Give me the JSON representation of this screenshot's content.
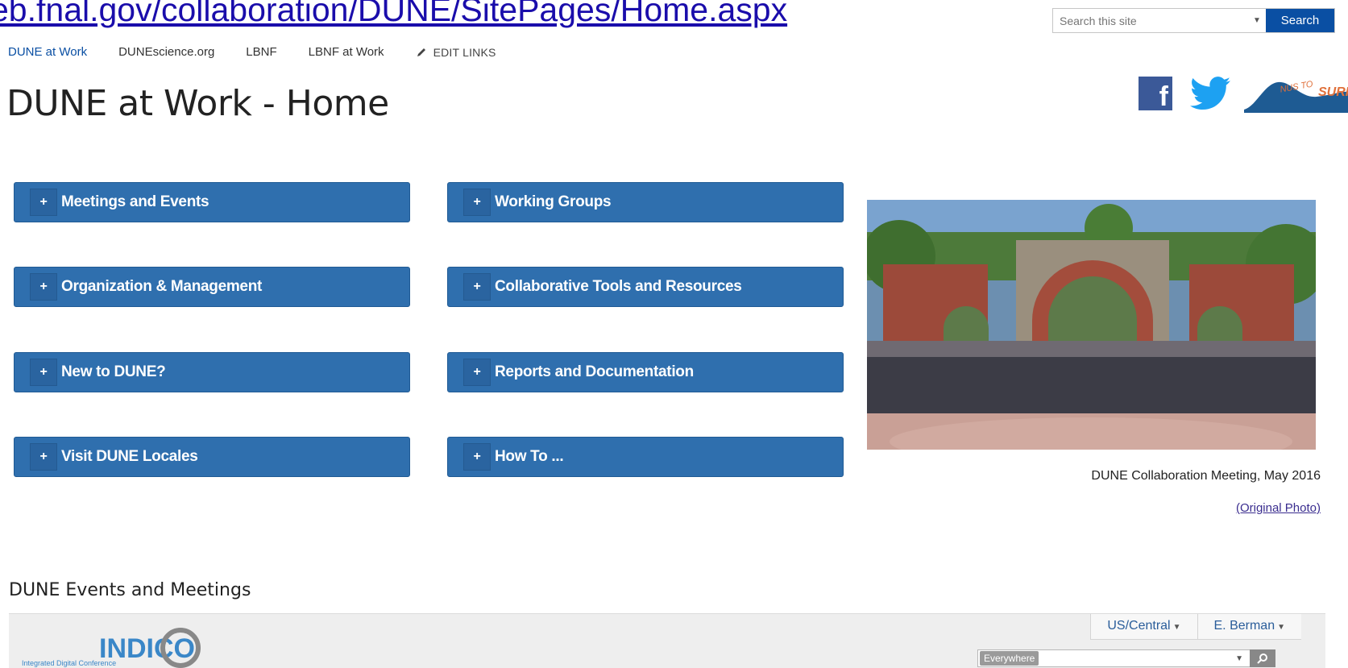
{
  "browser": {
    "url_text": "eb.fnal.gov/collaboration/DUNE/SitePages/Home.aspx"
  },
  "search": {
    "placeholder": "Search this site",
    "button_label": "Search"
  },
  "topnav": {
    "items": [
      {
        "label": "DUNE at Work",
        "active": true
      },
      {
        "label": "DUNEscience.org",
        "active": false
      },
      {
        "label": "LBNF",
        "active": false
      },
      {
        "label": "LBNF at Work",
        "active": false
      }
    ],
    "edit_links_label": "EDIT LINKS"
  },
  "page": {
    "title": "DUNE at Work - Home"
  },
  "social": {
    "facebook_glyph": "f",
    "surf_logo_text": "NUS TO SURF"
  },
  "accordions": {
    "left": [
      {
        "label": "Meetings and Events"
      },
      {
        "label": "Organization & Management"
      },
      {
        "label": "New to DUNE?"
      },
      {
        "label": "Visit DUNE Locales"
      }
    ],
    "right": [
      {
        "label": "Working Groups"
      },
      {
        "label": "Collaborative Tools and Resources"
      },
      {
        "label": "Reports and Documentation"
      },
      {
        "label": "How To ..."
      }
    ],
    "expand_glyph": "+"
  },
  "photo": {
    "caption": "DUNE Collaboration Meeting, May 2016",
    "link_text": "(Original Photo)"
  },
  "events": {
    "heading": "DUNE Events and Meetings",
    "indico": {
      "logo_text": "INDICO",
      "logo_tagline": "Integrated Digital Conference",
      "timezone": "US/Central",
      "user": "E. Berman",
      "search_scope": "Everywhere"
    }
  },
  "colors": {
    "accordion_blue": "#2f6fae",
    "search_button_blue": "#0a4fa3",
    "facebook_blue": "#3b5998",
    "twitter_blue": "#1da1f2"
  }
}
